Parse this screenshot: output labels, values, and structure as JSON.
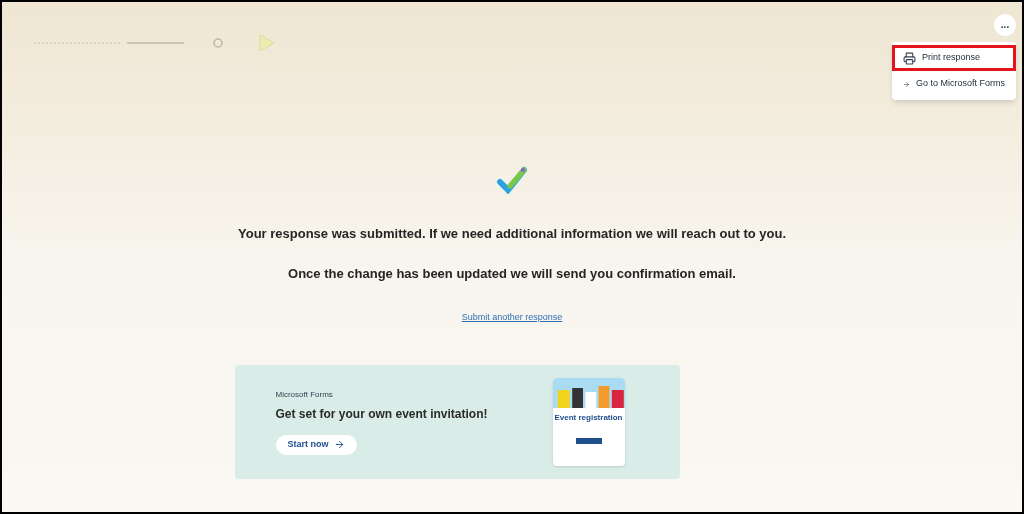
{
  "menu": {
    "more_button": "...",
    "items": [
      {
        "kind": "print",
        "label": "Print response",
        "highlighted": true
      },
      {
        "kind": "arrow",
        "label": "Go to Microsoft Forms",
        "highlighted": false
      }
    ]
  },
  "messages": [
    "Your response was submitted. If we need additional information we will reach out to you.",
    "Once the change has been updated we will send you confirmation email."
  ],
  "link": "Submit another response",
  "promo": {
    "brand": "Microsoft Forms",
    "headline": "Get set for your own event invitation!",
    "button": "Start now",
    "preview_title": "Event registration"
  }
}
